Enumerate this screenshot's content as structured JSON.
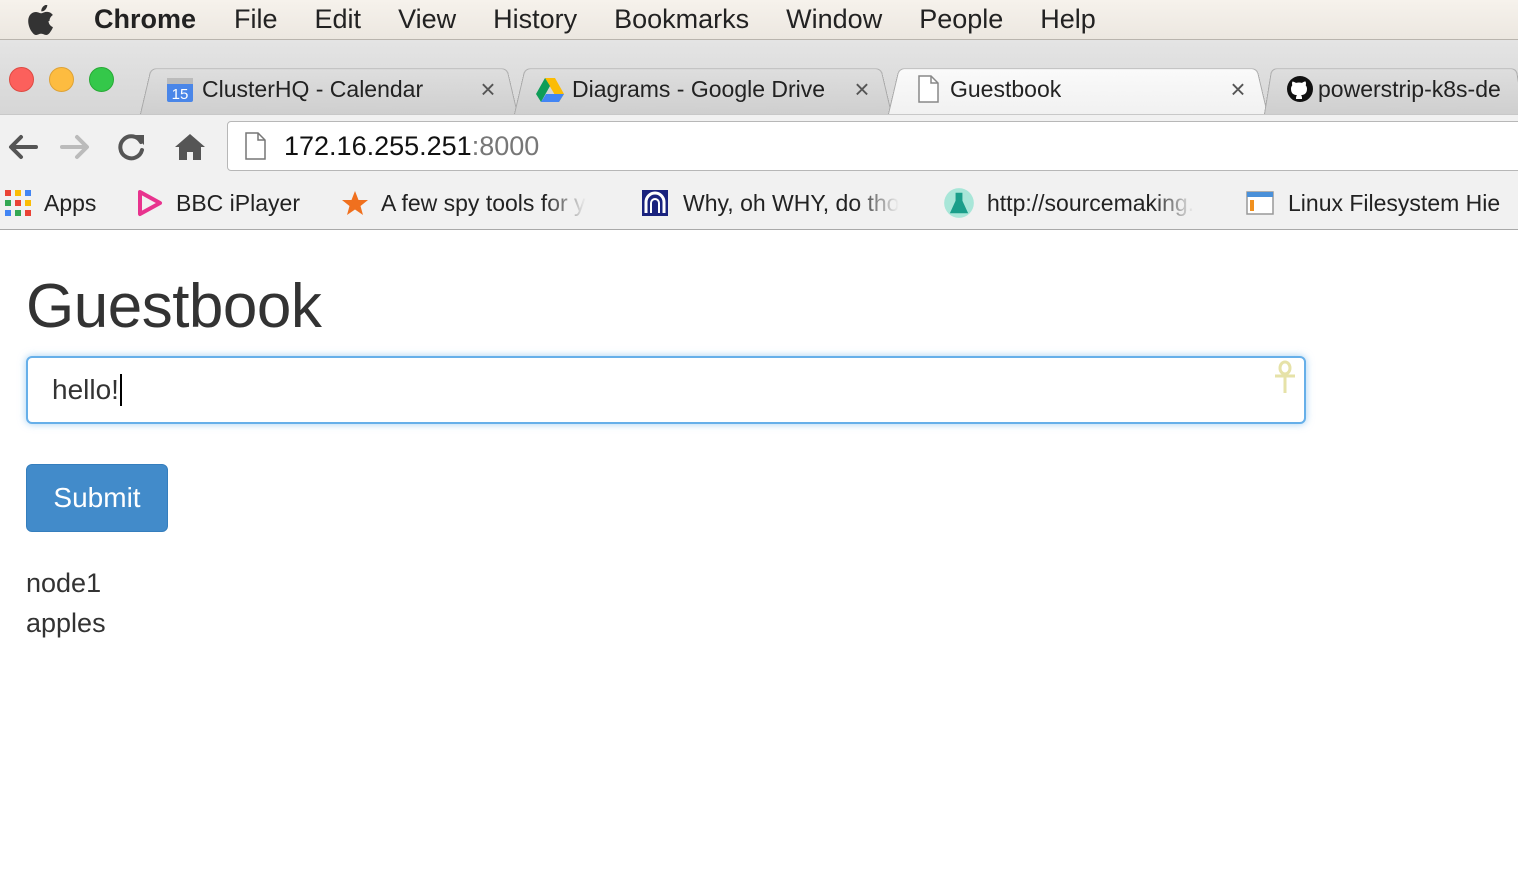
{
  "menubar": {
    "app_name": "Chrome",
    "items": [
      "File",
      "Edit",
      "View",
      "History",
      "Bookmarks",
      "Window",
      "People",
      "Help"
    ]
  },
  "tabs": [
    {
      "title": "ClusterHQ - Calendar",
      "favicon": "calendar-icon",
      "favicon_text": "15",
      "close": "×"
    },
    {
      "title": "Diagrams - Google Drive",
      "favicon": "google-drive-icon",
      "close": "×"
    },
    {
      "title": "Guestbook",
      "favicon": "blank-page-icon",
      "close": "×",
      "active": true
    },
    {
      "title": "powerstrip-k8s-de",
      "favicon": "github-icon"
    }
  ],
  "toolbar": {
    "url_host": "172.16.255.251",
    "url_port": ":8000"
  },
  "bookmarks": [
    {
      "label": "Apps",
      "icon": "apps-grid-icon"
    },
    {
      "label": "BBC iPlayer",
      "icon": "iplayer-icon"
    },
    {
      "label": "A few spy tools for y",
      "icon": "star-icon"
    },
    {
      "label": "Why, oh WHY, do tho",
      "icon": "codinghorror-icon"
    },
    {
      "label": "http://sourcemaking.",
      "icon": "sourcemaking-icon"
    },
    {
      "label": "Linux Filesystem Hie",
      "icon": "window-icon"
    }
  ],
  "page": {
    "title": "Guestbook",
    "input_value": "hello!",
    "submit_label": "Submit",
    "entries": [
      "node1",
      "apples"
    ]
  },
  "colors": {
    "accent_focus": "#66afe9",
    "button_primary": "#428bca",
    "text": "#333333"
  }
}
